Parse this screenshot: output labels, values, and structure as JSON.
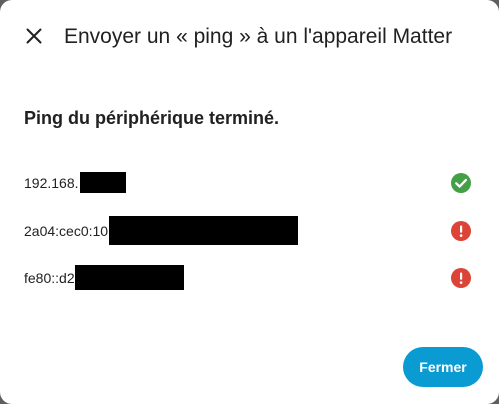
{
  "dialog": {
    "title": "Envoyer un « ping » à un l'appareil Matter",
    "close_icon": "close-icon",
    "heading": "Ping du périphérique terminé.",
    "rows": [
      {
        "address": "192.168.",
        "status": "success",
        "status_icon": "check-circle-icon",
        "status_color": "#43a047"
      },
      {
        "address": "2a04:cec0:10",
        "status": "error",
        "status_icon": "alert-circle-icon",
        "status_color": "#db4437"
      },
      {
        "address": "fe80::d2",
        "status": "error",
        "status_icon": "alert-circle-icon",
        "status_color": "#db4437"
      }
    ],
    "close_button_label": "Fermer",
    "accent_color": "#0a9bd3"
  }
}
